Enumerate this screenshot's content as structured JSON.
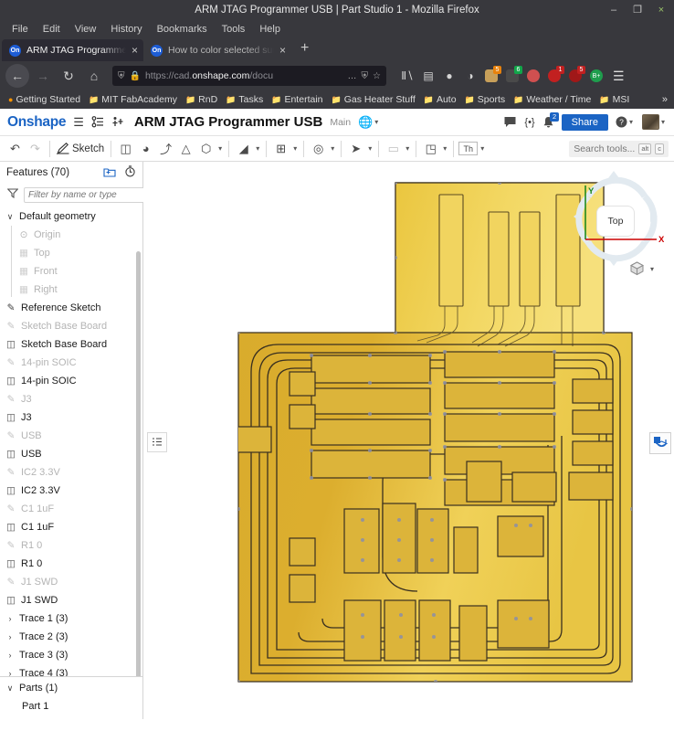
{
  "browser": {
    "window_title": "ARM JTAG Programmer USB | Part Studio 1 - Mozilla Firefox",
    "window_controls": {
      "minimize": "–",
      "maximize": "❐",
      "close": "×"
    },
    "menus": [
      "File",
      "Edit",
      "View",
      "History",
      "Bookmarks",
      "Tools",
      "Help"
    ],
    "tabs": [
      {
        "title": "ARM JTAG Programmer US",
        "favicon_text": "On",
        "active": true,
        "close": "×"
      },
      {
        "title": "How to color selected surf",
        "favicon_text": "On",
        "active": false,
        "close": "×"
      }
    ],
    "new_tab_label": "+",
    "nav": {
      "back": "←",
      "forward": "→",
      "reload": "↻",
      "home": "⌂"
    },
    "url": {
      "prefix": "https://cad.",
      "domain": "onshape.com",
      "suffix": "/docu",
      "shield": "⛨",
      "lock": "🔒",
      "more": "…",
      "tracking": "⛨",
      "bookmark": "☆"
    },
    "extensions": [
      {
        "name": "library-icon",
        "glyph": "Ⅱ∖",
        "color": "#d9d9d9",
        "badge": "",
        "badge_color": ""
      },
      {
        "name": "sidebar-icon",
        "glyph": "▤",
        "color": "#d9d9d9",
        "badge": "",
        "badge_color": ""
      },
      {
        "name": "account-icon",
        "glyph": "●",
        "color": "#d9d9d9",
        "badge": "",
        "badge_color": ""
      },
      {
        "name": "yin-yang-ext-icon",
        "glyph": "◑",
        "color": "#e6e6e6",
        "badge": "",
        "badge_color": ""
      },
      {
        "name": "orange-ext-icon",
        "glyph": "❦",
        "color": "#c8a05a",
        "badge": "5",
        "badge_color": "#e8820c"
      },
      {
        "name": "dark-ext-icon",
        "glyph": "❦",
        "color": "#4a4a4a",
        "badge": "6",
        "badge_color": "#12a64a"
      },
      {
        "name": "mask-ext-icon",
        "glyph": "●",
        "color": "#d05050",
        "badge": "",
        "badge_color": ""
      },
      {
        "name": "red-ext-icon",
        "glyph": "●",
        "color": "#c22020",
        "badge": "1",
        "badge_color": "#c22020"
      },
      {
        "name": "uo-ext-icon",
        "glyph": "●",
        "color": "#a01818",
        "badge": "5",
        "badge_color": "#c22020"
      },
      {
        "name": "bplus-ext-icon",
        "glyph": "B+",
        "color": "#1f9d4d",
        "badge": "",
        "badge_color": ""
      }
    ],
    "app_menu": "☰",
    "bookmarks": [
      {
        "label": "Getting Started",
        "icon": "firefox-icon"
      },
      {
        "label": "MIT FabAcademy",
        "icon": "folder-icon"
      },
      {
        "label": "RnD",
        "icon": "folder-icon"
      },
      {
        "label": "Tasks",
        "icon": "folder-icon"
      },
      {
        "label": "Entertain",
        "icon": "folder-icon"
      },
      {
        "label": "Gas Heater Stuff",
        "icon": "folder-icon"
      },
      {
        "label": "Auto",
        "icon": "folder-icon"
      },
      {
        "label": "Sports",
        "icon": "folder-icon"
      },
      {
        "label": "Weather / Time",
        "icon": "folder-icon"
      },
      {
        "label": "MSI",
        "icon": "folder-icon"
      }
    ],
    "bookmarks_overflow": "»"
  },
  "onshape": {
    "logo": "Onshape",
    "document_title": "ARM JTAG Programmer USB",
    "branch": "Main",
    "header_icons": {
      "menu": "☰",
      "versions": "⎇",
      "insert": "↓",
      "globe": "🌐",
      "globe_caret": "▾",
      "comments": "💬",
      "variables": "{•}",
      "notifications": "🔔",
      "notification_count": "2",
      "help": "?",
      "help_caret": "▾",
      "account_caret": "▾"
    },
    "share_label": "Share",
    "toolbar": {
      "undo": "↶",
      "redo": "↷",
      "sketch_label": "Sketch",
      "tools": [
        {
          "name": "extrude-tool",
          "glyph": "◫",
          "caret": false
        },
        {
          "name": "revolve-tool",
          "glyph": "◕",
          "caret": false
        },
        {
          "name": "sweep-tool",
          "glyph": "⤴",
          "caret": false
        },
        {
          "name": "loft-tool",
          "glyph": "△",
          "caret": false
        },
        {
          "name": "hole-tool",
          "glyph": "⬡",
          "caret": true
        },
        {
          "name": "fillet-tool",
          "glyph": "◢",
          "caret": true
        },
        {
          "name": "pattern-tool",
          "glyph": "⊞",
          "caret": true
        },
        {
          "name": "boolean-tool",
          "glyph": "◎",
          "caret": true
        },
        {
          "name": "draft-tool",
          "glyph": "➤",
          "caret": true
        },
        {
          "name": "shell-tool",
          "glyph": "▭",
          "caret": true
        },
        {
          "name": "transform-tool",
          "glyph": "◳",
          "caret": true
        },
        {
          "name": "thicken-tool",
          "glyph": "Th",
          "caret": true
        }
      ],
      "search_placeholder": "Search tools...",
      "search_keys": [
        "alt",
        "c"
      ]
    },
    "feature_tree": {
      "title": "Features (70)",
      "head_icons": {
        "insert_feature": "🗂",
        "rollback": "⏱"
      },
      "filter_icon": "∇",
      "filter_placeholder": "Filter by name or type",
      "groups": [
        {
          "label": "Default geometry",
          "expanded": true,
          "twisty": "∨",
          "children": [
            {
              "label": "Origin",
              "icon": "origin-icon",
              "muted": true
            },
            {
              "label": "Top",
              "icon": "plane-icon",
              "muted": true
            },
            {
              "label": "Front",
              "icon": "plane-icon",
              "muted": true
            },
            {
              "label": "Right",
              "icon": "plane-icon",
              "muted": true
            }
          ]
        }
      ],
      "features": [
        {
          "label": "Reference Sketch",
          "icon": "sketch-icon",
          "muted": false
        },
        {
          "label": "Sketch Base Board",
          "icon": "sketch-icon",
          "muted": true
        },
        {
          "label": "Sketch Base Board",
          "icon": "extrude-icon",
          "muted": false
        },
        {
          "label": "14-pin SOIC",
          "icon": "sketch-icon",
          "muted": true
        },
        {
          "label": "14-pin SOIC",
          "icon": "extrude-icon",
          "muted": false
        },
        {
          "label": "J3",
          "icon": "sketch-icon",
          "muted": true
        },
        {
          "label": "J3",
          "icon": "extrude-icon",
          "muted": false
        },
        {
          "label": "USB",
          "icon": "sketch-icon",
          "muted": true
        },
        {
          "label": "USB",
          "icon": "extrude-icon",
          "muted": false
        },
        {
          "label": "IC2 3.3V",
          "icon": "sketch-icon",
          "muted": true
        },
        {
          "label": "IC2 3.3V",
          "icon": "extrude-icon",
          "muted": false
        },
        {
          "label": "C1 1uF",
          "icon": "sketch-icon",
          "muted": true
        },
        {
          "label": "C1 1uF",
          "icon": "extrude-icon",
          "muted": false
        },
        {
          "label": "R1 0",
          "icon": "sketch-icon",
          "muted": true
        },
        {
          "label": "R1 0",
          "icon": "extrude-icon",
          "muted": false
        },
        {
          "label": "J1 SWD",
          "icon": "sketch-icon",
          "muted": true
        },
        {
          "label": "J1 SWD",
          "icon": "extrude-icon",
          "muted": false
        }
      ],
      "folders": [
        {
          "label": "Trace 1 (3)",
          "twisty": "›"
        },
        {
          "label": "Trace 2 (3)",
          "twisty": "›"
        },
        {
          "label": "Trace 3 (3)",
          "twisty": "›"
        },
        {
          "label": "Trace 4 (3)",
          "twisty": "›"
        }
      ],
      "parts": {
        "title": "Parts (1)",
        "twisty": "∨",
        "items": [
          {
            "label": "Part 1"
          }
        ]
      }
    },
    "viewport": {
      "view_cube_face": "Top",
      "axis_x": "X",
      "axis_y": "Y",
      "axis_x_color": "#cc0000",
      "axis_y_color": "#1f8a1f",
      "display_style_icon": "⬡",
      "display_style_caret": "▾",
      "left_panel_tab_icon": "☰",
      "right_panel_tab_icon": "⬢",
      "pcb_fill_color": "#d6a92a",
      "pcb_highlight_color": "#f2d761",
      "pcb_edge_color": "#3a3020"
    }
  }
}
